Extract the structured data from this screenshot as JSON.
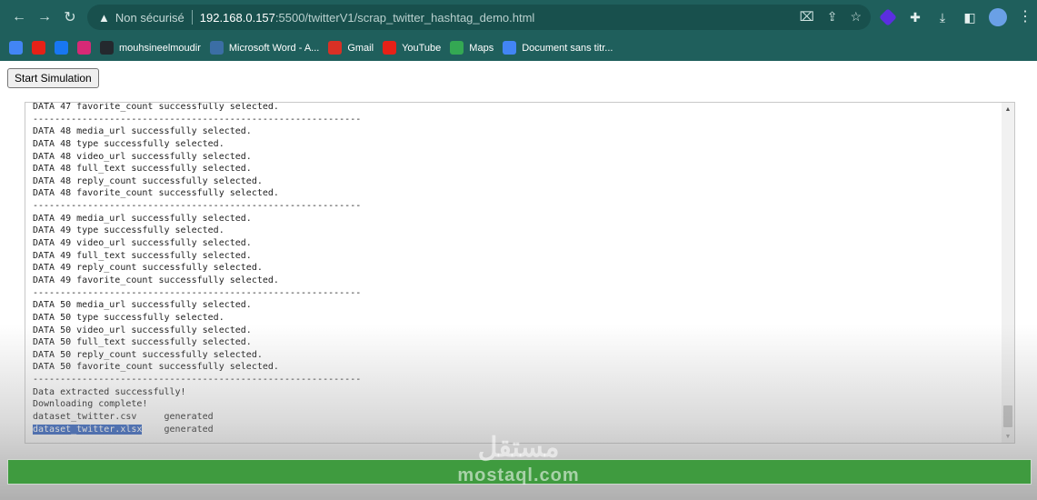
{
  "browser": {
    "security_label": "Non sécurisé",
    "url_host": "192.168.0.157",
    "url_path": ":5500/twitterV1/scrap_twitter_hashtag_demo.html"
  },
  "bookmarks": [
    {
      "label": "",
      "icon": "google-icon",
      "color": "#4285f4"
    },
    {
      "label": "",
      "icon": "youtube-icon",
      "color": "#e62117"
    },
    {
      "label": "",
      "icon": "facebook-icon",
      "color": "#1877f2"
    },
    {
      "label": "",
      "icon": "instagram-icon",
      "color": "#d62976"
    },
    {
      "label": "mouhsineelmoudir",
      "icon": "github-icon",
      "color": "#24292e"
    },
    {
      "label": "Microsoft Word - A...",
      "icon": "globe-icon",
      "color": "#3b6ea5"
    },
    {
      "label": "Gmail",
      "icon": "gmail-icon",
      "color": "#d93025"
    },
    {
      "label": "YouTube",
      "icon": "youtube-icon",
      "color": "#e62117"
    },
    {
      "label": "Maps",
      "icon": "maps-icon",
      "color": "#34a853"
    },
    {
      "label": "Document sans titr...",
      "icon": "docs-icon",
      "color": "#4285f4"
    }
  ],
  "page": {
    "start_button": "Start Simulation",
    "log_lines": [
      "DATA 47 favorite_count successfully selected.",
      "------------------------------------------------------------",
      "DATA 48 media_url successfully selected.",
      "DATA 48 type successfully selected.",
      "DATA 48 video_url successfully selected.",
      "DATA 48 full_text successfully selected.",
      "DATA 48 reply_count successfully selected.",
      "DATA 48 favorite_count successfully selected.",
      "------------------------------------------------------------",
      "DATA 49 media_url successfully selected.",
      "DATA 49 type successfully selected.",
      "DATA 49 video_url successfully selected.",
      "DATA 49 full_text successfully selected.",
      "DATA 49 reply_count successfully selected.",
      "DATA 49 favorite_count successfully selected.",
      "------------------------------------------------------------",
      "DATA 50 media_url successfully selected.",
      "DATA 50 type successfully selected.",
      "DATA 50 video_url successfully selected.",
      "DATA 50 full_text successfully selected.",
      "DATA 50 reply_count successfully selected.",
      "DATA 50 favorite_count successfully selected.",
      "------------------------------------------------------------",
      "Data extracted successfully!",
      "Downloading complete!"
    ],
    "files": [
      {
        "name": "dataset_twitter.csv",
        "status": "generated",
        "selected": false
      },
      {
        "name": "dataset_twitter.xlsx",
        "status": "generated",
        "selected": true
      }
    ],
    "progress_fraction": 1.0,
    "watermark": {
      "logo": "مستقل",
      "text": "mostaql.com"
    }
  },
  "colors": {
    "chrome": "#1f5f5c",
    "progress": "#3f9b3f",
    "selection": "#2a5fc2"
  }
}
